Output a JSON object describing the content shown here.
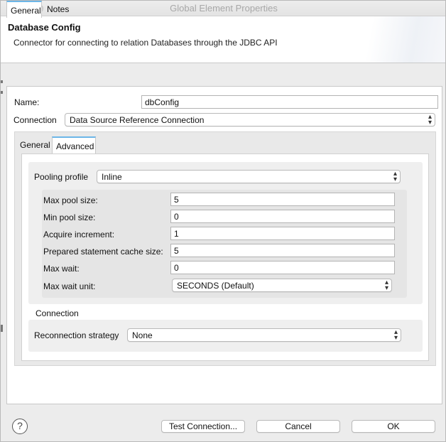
{
  "window": {
    "title": "Global Element Properties"
  },
  "header": {
    "title": "Database Config",
    "description": "Connector for connecting to relation Databases through the JDBC API"
  },
  "tabs": [
    {
      "label": "General",
      "active": true
    },
    {
      "label": "Notes",
      "active": false
    }
  ],
  "form": {
    "name_label": "Name:",
    "name_value": "dbConfig",
    "connection_label": "Connection",
    "connection_value": "Data Source Reference Connection"
  },
  "inner_tabs": [
    {
      "label": "General",
      "active": false
    },
    {
      "label": "Advanced",
      "active": true
    }
  ],
  "pooling": {
    "profile_label": "Pooling profile",
    "profile_value": "Inline",
    "fields": [
      {
        "label": "Max pool size:",
        "value": "5"
      },
      {
        "label": "Min pool size:",
        "value": "0"
      },
      {
        "label": "Acquire increment:",
        "value": "1"
      },
      {
        "label": "Prepared statement cache size:",
        "value": "5"
      },
      {
        "label": "Max wait:",
        "value": "0"
      }
    ],
    "max_wait_unit_label": "Max wait unit:",
    "max_wait_unit_value": "SECONDS (Default)"
  },
  "connection_section": {
    "title": "Connection",
    "reconnection_label": "Reconnection strategy",
    "reconnection_value": "None"
  },
  "footer": {
    "help_icon": "?",
    "test_connection": "Test Connection...",
    "cancel": "Cancel",
    "ok": "OK"
  },
  "icons": {
    "dropdown": "chevron-up-down-icon",
    "help": "question-circle-icon"
  },
  "colors": {
    "active_tab_accent": "#6cb6e8",
    "window_bg": "#ececec"
  }
}
